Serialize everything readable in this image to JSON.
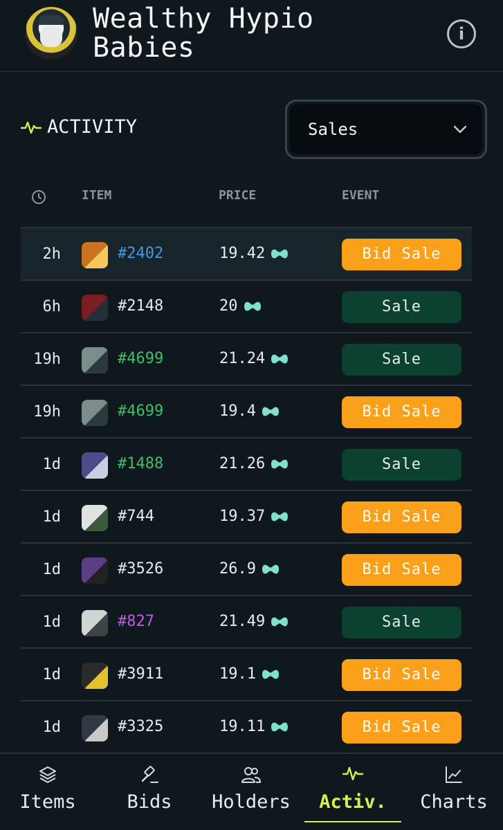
{
  "header": {
    "title_line1": "Wealthy Hypio",
    "title_line2": "Babies"
  },
  "section": {
    "label": "ACTIVITY",
    "icon": "activity-pulse-icon",
    "accent": "#d8f04a"
  },
  "filter": {
    "selected": "Sales"
  },
  "columns": {
    "item": "ITEM",
    "price": "PRICE",
    "event": "EVENT"
  },
  "rows": [
    {
      "time": "2h",
      "item": "#2402",
      "item_color": "#3b9be8",
      "price": "19.42",
      "event": "Bid Sale",
      "event_kind": "bid",
      "thumb": [
        "#c8741e",
        "#f6c85a"
      ]
    },
    {
      "time": "6h",
      "item": "#2148",
      "item_color": "#e8ecee",
      "price": "20",
      "event": "Sale",
      "event_kind": "sale",
      "thumb": [
        "#7a1e22",
        "#23303a"
      ]
    },
    {
      "time": "19h",
      "item": "#4699",
      "item_color": "#3fbf6a",
      "price": "21.24",
      "event": "Sale",
      "event_kind": "sale",
      "thumb": [
        "#7b8d8a",
        "#2b3a3a"
      ]
    },
    {
      "time": "19h",
      "item": "#4699",
      "item_color": "#3fbf6a",
      "price": "19.4",
      "event": "Bid Sale",
      "event_kind": "bid",
      "thumb": [
        "#7b8d8a",
        "#2b3a3a"
      ]
    },
    {
      "time": "1d",
      "item": "#1488",
      "item_color": "#3fbf6a",
      "price": "21.26",
      "event": "Sale",
      "event_kind": "sale",
      "thumb": [
        "#4a4d8a",
        "#c9cfe0"
      ]
    },
    {
      "time": "1d",
      "item": "#744",
      "item_color": "#e8ecee",
      "price": "19.37",
      "event": "Bid Sale",
      "event_kind": "bid",
      "thumb": [
        "#dfe3e0",
        "#3a5a3a"
      ]
    },
    {
      "time": "1d",
      "item": "#3526",
      "item_color": "#e8ecee",
      "price": "26.9",
      "event": "Bid Sale",
      "event_kind": "bid",
      "thumb": [
        "#5a3f86",
        "#222"
      ]
    },
    {
      "time": "1d",
      "item": "#827",
      "item_color": "#c05ae0",
      "price": "21.49",
      "event": "Sale",
      "event_kind": "sale",
      "thumb": [
        "#cfd3d2",
        "#3c4446"
      ]
    },
    {
      "time": "1d",
      "item": "#3911",
      "item_color": "#e8ecee",
      "price": "19.1",
      "event": "Bid Sale",
      "event_kind": "bid",
      "thumb": [
        "#2a2a2a",
        "#e3c12e"
      ]
    },
    {
      "time": "1d",
      "item": "#3325",
      "item_color": "#e8ecee",
      "price": "19.11",
      "event": "Bid Sale",
      "event_kind": "bid",
      "thumb": [
        "#2f3a44",
        "#c9c9c9"
      ]
    }
  ],
  "nav": [
    {
      "label": "Items",
      "icon": "layers-icon",
      "active": false
    },
    {
      "label": "Bids",
      "icon": "gavel-icon",
      "active": false
    },
    {
      "label": "Holders",
      "icon": "users-icon",
      "active": false
    },
    {
      "label": "Activ.",
      "icon": "activity-icon",
      "active": true
    },
    {
      "label": "Charts",
      "icon": "chart-icon",
      "active": false
    }
  ]
}
